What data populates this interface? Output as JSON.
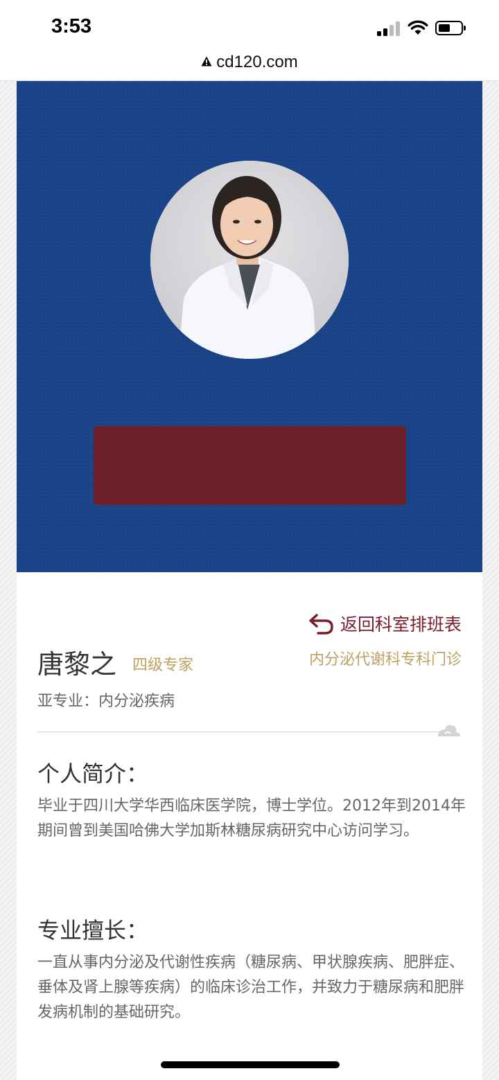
{
  "status_bar": {
    "time": "3:53"
  },
  "browser": {
    "url": "cd120.com"
  },
  "doctor": {
    "name": "唐黎之",
    "title": "四级专家",
    "subspecialty": "亚专业：内分泌疾病",
    "department": "内分泌代谢科专科门诊"
  },
  "actions": {
    "back_label": "返回科室排班表"
  },
  "bio": {
    "heading": "个人简介：",
    "text": "毕业于四川大学华西临床医学院，博士学位。2012年到2014年期间曾到美国哈佛大学加斯林糖尿病研究中心访问学习。"
  },
  "expertise": {
    "heading": "专业擅长：",
    "text": "一直从事内分泌及代谢性疾病（糖尿病、甲状腺疾病、肥胖症、垂体及肾上腺等疾病）的临床诊治工作，并致力于糖尿病和肥胖发病机制的基础研究。"
  },
  "colors": {
    "hero_blue": "#1a4287",
    "banner_maroon": "#6d1f2a",
    "accent_gold": "#bfa060",
    "link_maroon": "#7a1e2c"
  }
}
